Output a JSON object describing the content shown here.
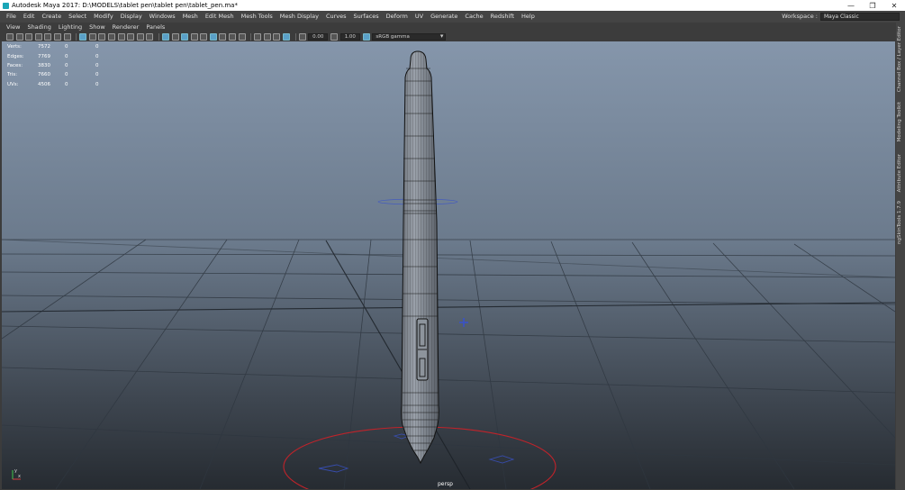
{
  "window": {
    "title": "Autodesk Maya 2017: D:\\MODELS\\tablet pen\\tablet pen\\tablet_pen.ma*",
    "min_glyph": "—",
    "restore_glyph": "❐",
    "close_glyph": "✕"
  },
  "menubar": {
    "items": [
      "File",
      "Edit",
      "Create",
      "Select",
      "Modify",
      "Display",
      "Windows",
      "Mesh",
      "Edit Mesh",
      "Mesh Tools",
      "Mesh Display",
      "Curves",
      "Surfaces",
      "Deform",
      "UV",
      "Generate",
      "Cache",
      "Redshift",
      "Help"
    ],
    "workspace_label": "Workspace :",
    "workspace_value": "Maya Classic"
  },
  "panel_menu": {
    "items": [
      "View",
      "Shading",
      "Lighting",
      "Show",
      "Renderer",
      "Panels"
    ]
  },
  "toolbar": {
    "exposure_value": "0.00",
    "gamma_value": "1.00",
    "color_space": "sRGB gamma"
  },
  "hud": {
    "rows": [
      {
        "label": "Verts:",
        "a": "7572",
        "b": "0",
        "c": "0"
      },
      {
        "label": "Edges:",
        "a": "7769",
        "b": "0",
        "c": "0"
      },
      {
        "label": "Faces:",
        "a": "3830",
        "b": "0",
        "c": "0"
      },
      {
        "label": "Tris:",
        "a": "7660",
        "b": "0",
        "c": "0"
      },
      {
        "label": "UVs:",
        "a": "4506",
        "b": "0",
        "c": "0"
      }
    ]
  },
  "viewport": {
    "camera": "persp",
    "axis_x": "x",
    "axis_y": "y"
  },
  "side_tabs": {
    "items": [
      "Channel Box / Layer Editor",
      "Modeling Toolkit",
      "Attribute Editor",
      "ngSkinTools 1.7.9"
    ]
  },
  "colors": {
    "selection_circle": "#c0232a",
    "manipulator": "#3a52c8",
    "wire": "#111111"
  }
}
